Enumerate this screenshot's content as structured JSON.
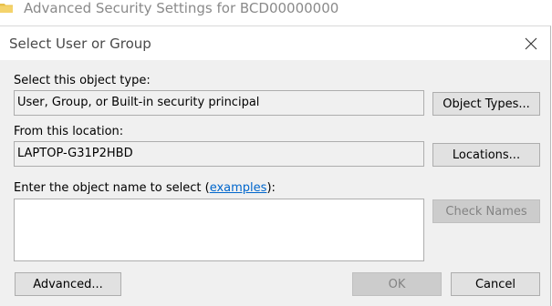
{
  "background_window": {
    "title": "Advanced Security Settings for BCD00000000",
    "icon": "folder-icon"
  },
  "dialog": {
    "title": "Select User or Group",
    "close_icon": "close-icon",
    "object_type": {
      "label": "Select this object type:",
      "value": "User, Group, or Built-in security principal",
      "button": "Object Types..."
    },
    "location": {
      "label": "From this location:",
      "value": "LAPTOP-G31P2HBD",
      "button": "Locations..."
    },
    "object_name": {
      "label_prefix": "Enter the object name to select (",
      "link": "examples",
      "label_suffix": "):",
      "value": "",
      "check_names_button": "Check Names"
    },
    "buttons": {
      "advanced": "Advanced...",
      "ok": "OK",
      "cancel": "Cancel"
    }
  },
  "colors": {
    "dialog_bg": "#f0f0f0",
    "link": "#0066cc",
    "disabled_text": "#838383"
  }
}
